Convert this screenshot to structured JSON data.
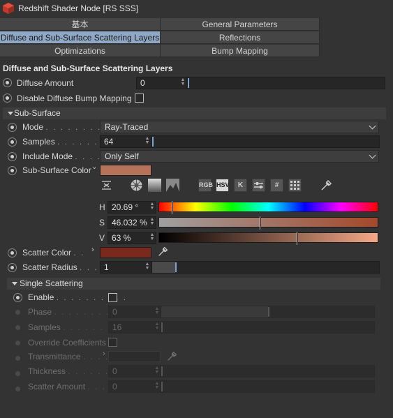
{
  "window": {
    "title": "Redshift Shader Node [RS SSS]"
  },
  "tabs": [
    {
      "label": "基本"
    },
    {
      "label": "General Parameters"
    },
    {
      "label": "Diffuse and Sub-Surface Scattering Layers"
    },
    {
      "label": "Reflections"
    },
    {
      "label": "Optimizations"
    },
    {
      "label": "Bump Mapping"
    }
  ],
  "section": {
    "title": "Diffuse and Sub-Surface Scattering Layers"
  },
  "diffuse_amount": {
    "label": "Diffuse Amount",
    "value": "0",
    "slider_fraction": 0.0
  },
  "disable_bump": {
    "label": "Disable Diffuse Bump Mapping",
    "checked": false
  },
  "subsurface": {
    "group_label": "Sub-Surface",
    "mode": {
      "label": "Mode",
      "value": "Ray-Traced"
    },
    "samples": {
      "label": "Samples",
      "value": "64",
      "slider_fraction": 0.06
    },
    "include_mode": {
      "label": "Include Mode",
      "value": "Only Self"
    },
    "color": {
      "label": "Sub-Surface Color",
      "hex": "#b5735a"
    },
    "color_picker": {
      "modes": [
        "RGB",
        "HSV",
        "K",
        "",
        "#",
        ""
      ],
      "active_mode": "HSV",
      "h": {
        "label": "H",
        "value": "20.69 °",
        "fraction": 0.057
      },
      "s": {
        "label": "S",
        "value": "46.032 %",
        "fraction": 0.46
      },
      "v": {
        "label": "V",
        "value": "63 %",
        "fraction": 0.63
      }
    },
    "scatter_color": {
      "label": "Scatter Color",
      "hex": "#7a2a1c"
    },
    "scatter_radius": {
      "label": "Scatter Radius",
      "value": "1",
      "slider_fraction": 0.1
    }
  },
  "single_scattering": {
    "group_label": "Single Scattering",
    "enable": {
      "label": "Enable",
      "checked": false
    },
    "phase": {
      "label": "Phase",
      "value": "0",
      "slider_fraction": 0.5
    },
    "samples": {
      "label": "Samples",
      "value": "16",
      "slider_fraction": 0.0
    },
    "override": {
      "label": "Override Coefficients",
      "checked": false
    },
    "transmittance": {
      "label": "Transmittance"
    },
    "thickness": {
      "label": "Thickness",
      "value": "0",
      "slider_fraction": 0.0
    },
    "scatter_amount": {
      "label": "Scatter Amount",
      "value": "0",
      "slider_fraction": 0.0
    }
  },
  "colors": {
    "accent": "#8ea8c6",
    "panel": "#333333"
  }
}
